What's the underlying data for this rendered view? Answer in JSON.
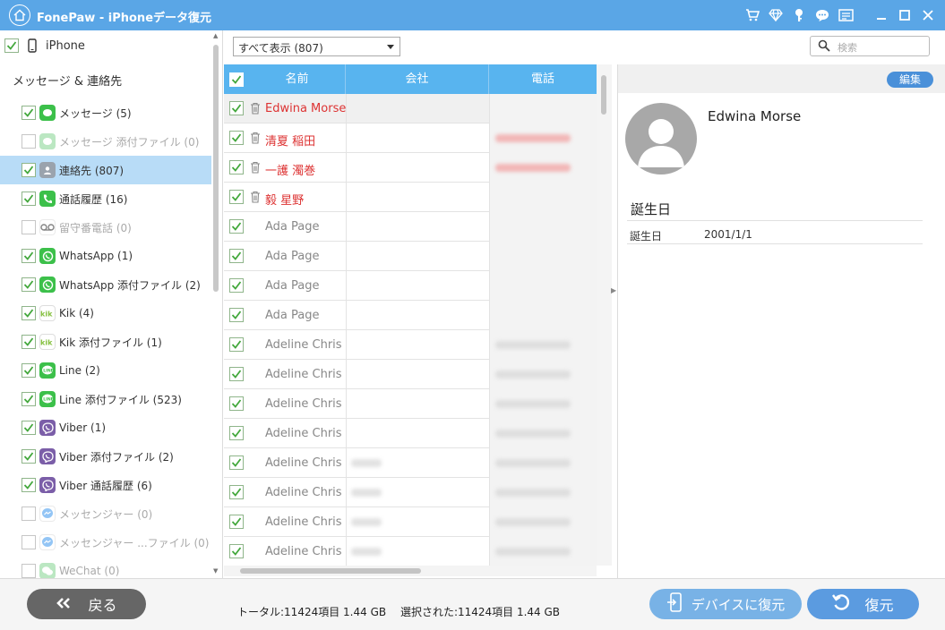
{
  "app": {
    "title": "FonePaw - iPhoneデータ復元"
  },
  "titlebar_icons": [
    "cart-icon",
    "diamond-icon",
    "key-icon",
    "chat-icon",
    "register-icon",
    "minimize-icon",
    "maximize-icon",
    "close-icon"
  ],
  "sidebar": {
    "device": "iPhone",
    "section": "メッセージ & 連絡先",
    "items": [
      {
        "label": "メッセージ (5)",
        "checked": true,
        "dim": false,
        "icon": "message-icon",
        "color": "#3cc04a"
      },
      {
        "label": "メッセージ 添付ファイル (0)",
        "checked": false,
        "dim": true,
        "icon": "message-attachment-icon",
        "color": "#8ed89a"
      },
      {
        "label": "連絡先 (807)",
        "checked": true,
        "dim": false,
        "icon": "contacts-icon",
        "color": "#9aa3ad",
        "selected": true
      },
      {
        "label": "通話履歴 (16)",
        "checked": true,
        "dim": false,
        "icon": "phone-icon",
        "color": "#3cc04a"
      },
      {
        "label": "留守番電話 (0)",
        "checked": false,
        "dim": true,
        "icon": "voicemail-icon",
        "color": "#ffffff"
      },
      {
        "label": "WhatsApp (1)",
        "checked": true,
        "dim": false,
        "icon": "whatsapp-icon",
        "color": "#3cc04a"
      },
      {
        "label": "WhatsApp 添付ファイル (2)",
        "checked": true,
        "dim": false,
        "icon": "whatsapp-attachment-icon",
        "color": "#3cc04a"
      },
      {
        "label": "Kik (4)",
        "checked": true,
        "dim": false,
        "icon": "kik-icon",
        "color": "#ffffff"
      },
      {
        "label": "Kik 添付ファイル (1)",
        "checked": true,
        "dim": false,
        "icon": "kik-attachment-icon",
        "color": "#ffffff"
      },
      {
        "label": "Line (2)",
        "checked": true,
        "dim": false,
        "icon": "line-icon",
        "color": "#3cc04a"
      },
      {
        "label": "Line 添付ファイル (523)",
        "checked": true,
        "dim": false,
        "icon": "line-attachment-icon",
        "color": "#3cc04a"
      },
      {
        "label": "Viber (1)",
        "checked": true,
        "dim": false,
        "icon": "viber-icon",
        "color": "#7b5ea8"
      },
      {
        "label": "Viber 添付ファイル (2)",
        "checked": true,
        "dim": false,
        "icon": "viber-attachment-icon",
        "color": "#7b5ea8"
      },
      {
        "label": "Viber 通話履歴 (6)",
        "checked": true,
        "dim": false,
        "icon": "viber-call-icon",
        "color": "#7b5ea8"
      },
      {
        "label": "メッセンジャー (0)",
        "checked": false,
        "dim": true,
        "icon": "messenger-icon",
        "color": "#ffffff"
      },
      {
        "label": "メッセンジャー ...ファイル (0)",
        "checked": false,
        "dim": true,
        "icon": "messenger-attachment-icon",
        "color": "#ffffff"
      },
      {
        "label": "WeChat (0)",
        "checked": false,
        "dim": true,
        "icon": "wechat-icon",
        "color": "#8ed89a"
      }
    ]
  },
  "filter": {
    "selected": "すべて表示 (807)"
  },
  "search": {
    "placeholder": "検索"
  },
  "table": {
    "columns": [
      "名前",
      "会社",
      "電話"
    ],
    "rows": [
      {
        "name": "Edwina Morse",
        "deleted": true,
        "company_blur": false,
        "phone_blur": ""
      },
      {
        "name": "清夏 稲田",
        "deleted": true,
        "company_blur": false,
        "phone_blur": "red"
      },
      {
        "name": "一護 濁巻",
        "deleted": true,
        "company_blur": false,
        "phone_blur": "red"
      },
      {
        "name": "毅 星野",
        "deleted": true,
        "company_blur": false,
        "phone_blur": ""
      },
      {
        "name": "Ada Page",
        "deleted": false,
        "company_blur": false,
        "phone_blur": ""
      },
      {
        "name": "Ada Page",
        "deleted": false,
        "company_blur": false,
        "phone_blur": ""
      },
      {
        "name": "Ada Page",
        "deleted": false,
        "company_blur": false,
        "phone_blur": ""
      },
      {
        "name": "Ada Page",
        "deleted": false,
        "company_blur": false,
        "phone_blur": ""
      },
      {
        "name": "Adeline Chris",
        "deleted": false,
        "company_blur": false,
        "phone_blur": "gray"
      },
      {
        "name": "Adeline Chris",
        "deleted": false,
        "company_blur": false,
        "phone_blur": "gray"
      },
      {
        "name": "Adeline Chris",
        "deleted": false,
        "company_blur": false,
        "phone_blur": "gray"
      },
      {
        "name": "Adeline Chris",
        "deleted": false,
        "company_blur": false,
        "phone_blur": "gray"
      },
      {
        "name": "Adeline Chris",
        "deleted": false,
        "company_blur": true,
        "phone_blur": "gray"
      },
      {
        "name": "Adeline Chris",
        "deleted": false,
        "company_blur": true,
        "phone_blur": "gray"
      },
      {
        "name": "Adeline Chris",
        "deleted": false,
        "company_blur": true,
        "phone_blur": "gray"
      },
      {
        "name": "Adeline Chris",
        "deleted": false,
        "company_blur": true,
        "phone_blur": "gray"
      }
    ]
  },
  "detail": {
    "edit_label": "編集",
    "name": "Edwina Morse",
    "section": "誕生日",
    "field_label": "誕生日",
    "field_value": "2001/1/1"
  },
  "bottom": {
    "back_label": "戻る",
    "total": "トータル:11424項目 1.44 GB",
    "selected": "選択された:11424項目 1.44 GB",
    "device_restore_label": "デバイスに復元",
    "restore_label": "復元"
  },
  "colors": {
    "accent": "#5aa6e6",
    "header": "#58b4ef",
    "deleted_text": "#dd3333",
    "check": "#43a83c"
  }
}
